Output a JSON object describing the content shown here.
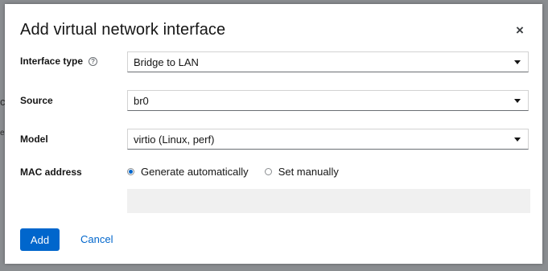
{
  "background_fragments": {
    "a": "c",
    "b": "e"
  },
  "dialog": {
    "title": "Add virtual network interface",
    "close_glyph": "×"
  },
  "fields": {
    "interface_type": {
      "label": "Interface type",
      "help_glyph": "?",
      "value": "Bridge to LAN"
    },
    "source": {
      "label": "Source",
      "value": "br0"
    },
    "model": {
      "label": "Model",
      "value": "virtio (Linux, perf)"
    },
    "mac_address": {
      "label": "MAC address",
      "options": [
        "Generate automatically",
        "Set manually"
      ],
      "selected": "Generate automatically",
      "value": ""
    }
  },
  "footer": {
    "add_label": "Add",
    "cancel_label": "Cancel"
  },
  "colors": {
    "primary": "#0066cc",
    "backdrop": "#8a8d90",
    "disabled_field": "#f0f0f0"
  },
  "icons": [
    "close-icon",
    "help-icon",
    "caret-down-icon"
  ]
}
